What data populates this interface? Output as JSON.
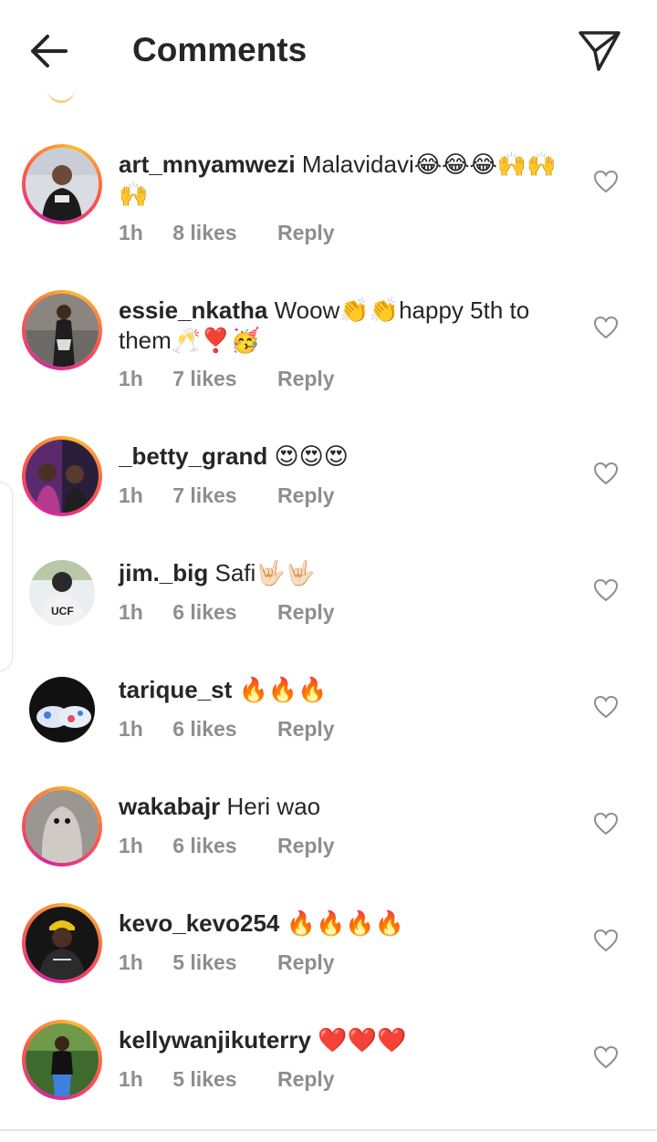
{
  "header": {
    "title": "Comments",
    "back_icon": "arrow-left-icon",
    "send_icon": "paper-plane-icon"
  },
  "colors": {
    "text": "#262626",
    "meta": "#8e8e8e",
    "story_ring": [
      "#d6249f",
      "#fd5949",
      "#fdbb2d"
    ]
  },
  "comments": [
    {
      "username": "art_mnyamwezi",
      "text": "Malavidavi😂😂😂🙌🙌🙌",
      "time": "1h",
      "likes": "8 likes",
      "reply": "Reply"
    },
    {
      "username": "essie_nkatha",
      "text": "Woow👏👏happy 5th to them🥂❣️🥳",
      "time": "1h",
      "likes": "7 likes",
      "reply": "Reply"
    },
    {
      "username": "_betty_grand",
      "text": "😍😍😍",
      "time": "1h",
      "likes": "7 likes",
      "reply": "Reply"
    },
    {
      "username": "jim._big",
      "text": "Safi🤟🏻🤟🏻",
      "time": "1h",
      "likes": "6 likes",
      "reply": "Reply"
    },
    {
      "username": "tarique_st",
      "text": "🔥🔥🔥",
      "time": "1h",
      "likes": "6 likes",
      "reply": "Reply"
    },
    {
      "username": "wakabajr",
      "text": "Heri wao",
      "time": "1h",
      "likes": "6 likes",
      "reply": "Reply"
    },
    {
      "username": "kevo_kevo254",
      "text": "🔥🔥🔥🔥",
      "time": "1h",
      "likes": "5 likes",
      "reply": "Reply"
    },
    {
      "username": "kellywanjikuterry",
      "text": "❤️❤️❤️",
      "time": "1h",
      "likes": "5 likes",
      "reply": "Reply"
    }
  ]
}
